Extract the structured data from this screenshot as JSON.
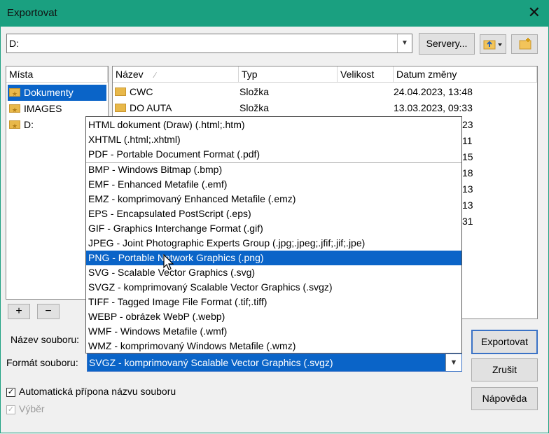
{
  "window": {
    "title": "Exportovat",
    "close_glyph": "✕"
  },
  "toolbar": {
    "path_value": "D:",
    "servers_label": "Servery...",
    "up_icon": "folder-up-icon",
    "new_folder_icon": "new-folder-icon"
  },
  "places": {
    "header": "Místa",
    "items": [
      {
        "label": "Dokumenty",
        "selected": true
      },
      {
        "label": "IMAGES",
        "selected": false
      },
      {
        "label": "D:",
        "selected": false
      }
    ],
    "add_label": "+",
    "remove_label": "−"
  },
  "files": {
    "columns": [
      "Název",
      "Typ",
      "Velikost",
      "Datum změny"
    ],
    "sort_indicator": "∕",
    "rows": [
      {
        "name": "CWC",
        "type": "Složka",
        "date": "24.04.2023, 13:48"
      },
      {
        "name": "DO AUTA",
        "type": "Složka",
        "date": "13.03.2023, 09:33"
      }
    ],
    "partial_dates": [
      "23",
      "11",
      "15",
      "18",
      "13",
      "13",
      "31"
    ]
  },
  "filename": {
    "label": "Název souboru:",
    "value": ""
  },
  "format": {
    "label": "Formát souboru:",
    "selected": "SVGZ - komprimovaný Scalable Vector Graphics (.svgz)",
    "options_group1": [
      "HTML dokument (Draw) (.html;.htm)",
      "XHTML (.html;.xhtml)",
      "PDF - Portable Document Format (.pdf)"
    ],
    "options_group2": [
      "BMP - Windows Bitmap (.bmp)",
      "EMF - Enhanced Metafile (.emf)",
      "EMZ - komprimovaný Enhanced Metafile (.emz)",
      "EPS - Encapsulated PostScript (.eps)",
      "GIF - Graphics Interchange Format (.gif)",
      "JPEG - Joint Photographic Experts Group (.jpg;.jpeg;.jfif;.jif;.jpe)",
      "PNG - Portable Network Graphics (.png)",
      "SVG - Scalable Vector Graphics (.svg)",
      "SVGZ - komprimovaný Scalable Vector Graphics (.svgz)",
      "TIFF - Tagged Image File Format (.tif;.tiff)",
      "WEBP - obrázek WebP (.webp)",
      "WMF - Windows Metafile (.wmf)",
      "WMZ - komprimovaný Windows Metafile (.wmz)"
    ],
    "highlighted": "PNG - Portable Network Graphics (.png)"
  },
  "options": {
    "auto_ext_label": "Automatická přípona názvu souboru",
    "auto_ext_checked": true,
    "selection_label": "Výběr",
    "selection_checked": true,
    "selection_enabled": false
  },
  "buttons": {
    "export": "Exportovat",
    "cancel": "Zrušit",
    "help": "Nápověda"
  },
  "colors": {
    "titlebar": "#1aa080",
    "highlight": "#0a64c8"
  }
}
